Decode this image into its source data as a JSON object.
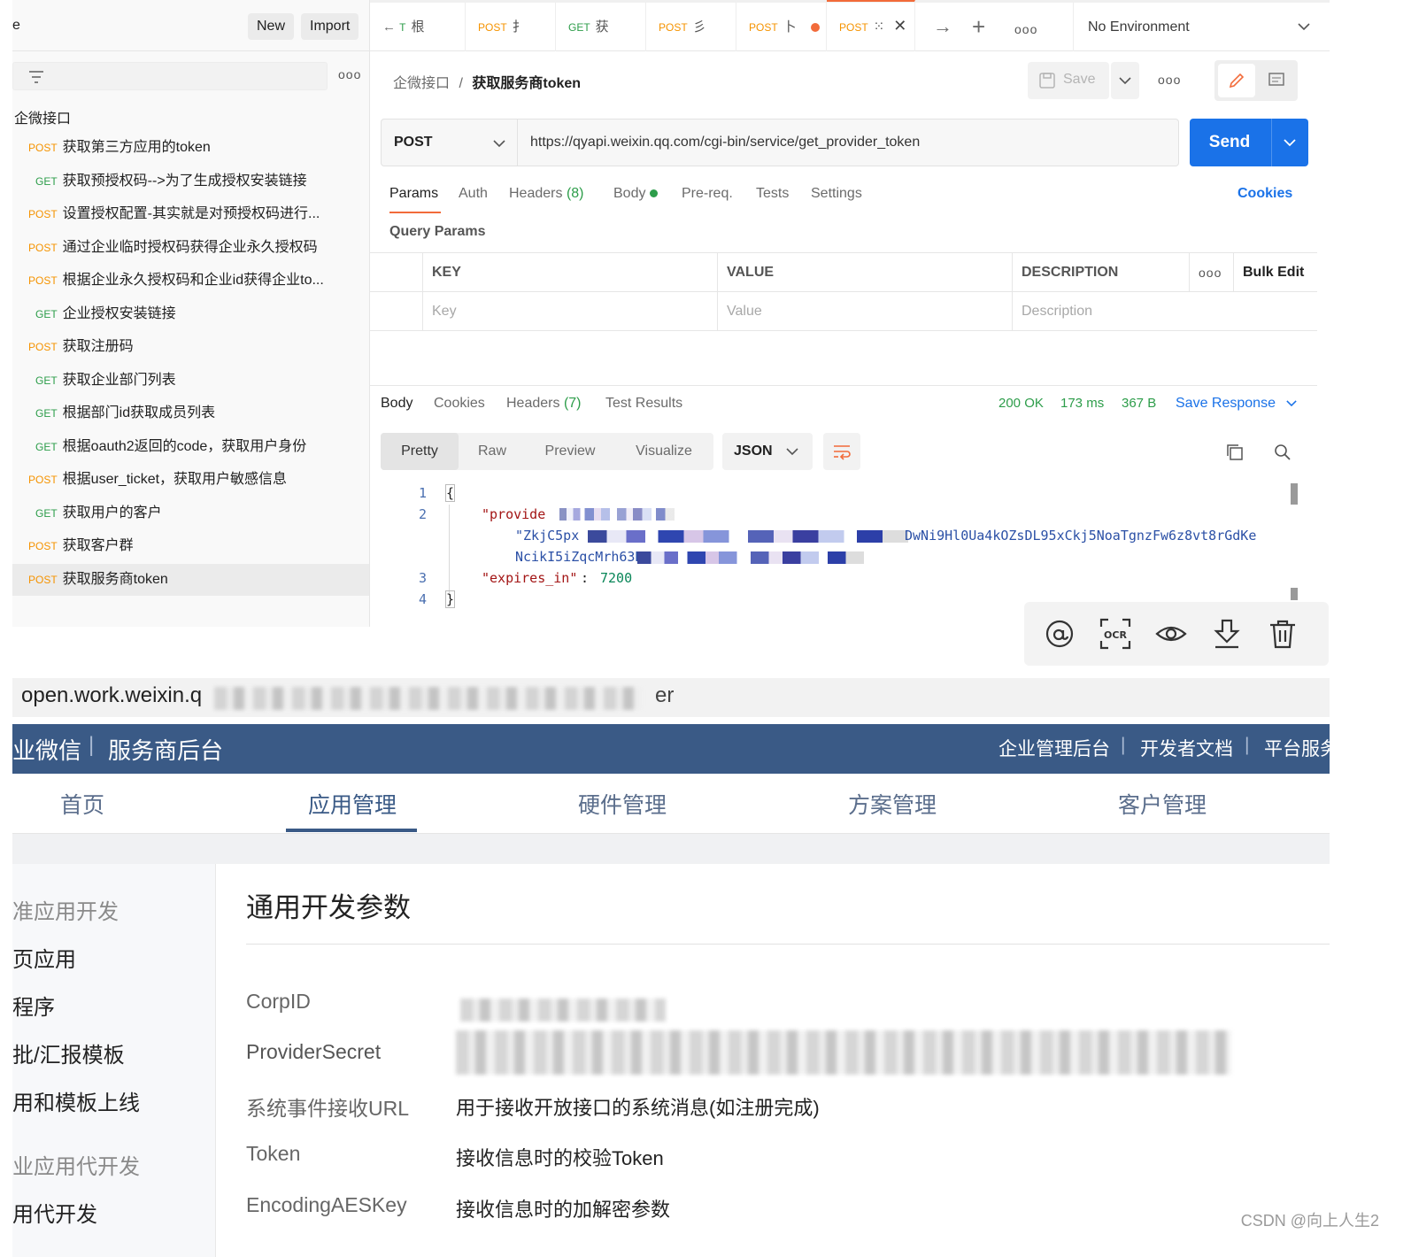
{
  "postman": {
    "sidebar": {
      "workspace_initial": "e",
      "new_label": "New",
      "import_label": "Import",
      "collection": "企微接口",
      "items": [
        {
          "method": "POST",
          "name": "获取第三方应用的token"
        },
        {
          "method": "GET",
          "name": "获取预授权码-->为了生成授权安装链接"
        },
        {
          "method": "POST",
          "name": "设置授权配置-其实就是对预授权码进行..."
        },
        {
          "method": "POST",
          "name": "通过企业临时授权码获得企业永久授权码"
        },
        {
          "method": "POST",
          "name": "根据企业永久授权码和企业id获得企业to..."
        },
        {
          "method": "GET",
          "name": "企业授权安装链接"
        },
        {
          "method": "POST",
          "name": "获取注册码"
        },
        {
          "method": "GET",
          "name": "获取企业部门列表"
        },
        {
          "method": "GET",
          "name": "根据部门id获取成员列表"
        },
        {
          "method": "GET",
          "name": "根据oauth2返回的code，获取用户身份"
        },
        {
          "method": "POST",
          "name": "根据user_ticket，获取用户敏感信息"
        },
        {
          "method": "GET",
          "name": "获取用户的客户"
        },
        {
          "method": "POST",
          "name": "获取客户群"
        },
        {
          "method": "POST",
          "name": "获取服务商token",
          "selected": true
        }
      ]
    },
    "tabs": [
      {
        "method": "T",
        "name": "根"
      },
      {
        "method": "POST",
        "name": "扌"
      },
      {
        "method": "GET",
        "name": "获"
      },
      {
        "method": "POST",
        "name": "彡"
      },
      {
        "method": "POST",
        "name": "卜",
        "unsaved": true
      },
      {
        "method": "POST",
        "name": "⁙",
        "active": true
      }
    ],
    "environment": "No Environment",
    "breadcrumb": {
      "collection": "企微接口",
      "separator": "/",
      "request": "获取服务商token"
    },
    "save_label": "Save",
    "request": {
      "method": "POST",
      "url": "https://qyapi.weixin.qq.com/cgi-bin/service/get_provider_token",
      "send_label": "Send"
    },
    "request_tabs": {
      "params": "Params",
      "auth": "Auth",
      "headers": "Headers",
      "headers_count": "(8)",
      "body": "Body",
      "prereq": "Pre-req.",
      "tests": "Tests",
      "settings": "Settings",
      "cookies": "Cookies"
    },
    "query_params": {
      "title": "Query Params",
      "col_key": "KEY",
      "col_value": "VALUE",
      "col_desc": "DESCRIPTION",
      "bulk_edit": "Bulk Edit",
      "ph_key": "Key",
      "ph_value": "Value",
      "ph_desc": "Description"
    },
    "response": {
      "tab_body": "Body",
      "tab_cookies": "Cookies",
      "tab_headers": "Headers",
      "headers_count": "(7)",
      "tab_tests": "Test Results",
      "status": "200 OK",
      "time": "173 ms",
      "size": "367 B",
      "save_response": "Save Response",
      "views": [
        "Pretty",
        "Raw",
        "Preview",
        "Visualize"
      ],
      "format": "JSON",
      "code": {
        "line_numbers": [
          "1",
          "2",
          "",
          "",
          "3",
          "4"
        ],
        "open_brace": "{",
        "key1": "\"provide",
        "val1_start": "\"ZkjC5px",
        "val1_end": "DwNi9Hl0Ua4kOZsDL95xCkj5NoaTgnzFw6z8vt8rGdKe",
        "val1_line2": "NcikI5iZqcMrh63K",
        "key2": "\"expires_in\"",
        "colon": ":",
        "val2": "7200",
        "close_brace": "}"
      }
    }
  },
  "weixin": {
    "address": "open.work.weixin.q",
    "address_tail": "er",
    "brand": "业微信",
    "brand_sep": "|",
    "brand_sub": "服务商后台",
    "header_links": [
      "企业管理后台",
      "开发者文档",
      "平台服务"
    ],
    "nav": [
      "首页",
      "应用管理",
      "硬件管理",
      "方案管理",
      "客户管理"
    ],
    "left_menu": [
      {
        "label": "准应用开发",
        "group": true
      },
      {
        "label": "页应用"
      },
      {
        "label": "程序"
      },
      {
        "label": "批/汇报模板"
      },
      {
        "label": "用和模板上线"
      },
      {
        "label": "业应用代开发",
        "group": true
      },
      {
        "label": "用代开发"
      }
    ],
    "section_title": "通用开发参数",
    "fields": [
      {
        "label": "CorpID",
        "value": ""
      },
      {
        "label": "ProviderSecret",
        "value": ""
      },
      {
        "label": "系统事件接收URL",
        "value": "用于接收开放接口的系统消息(如注册完成)"
      },
      {
        "label": "Token",
        "value": "接收信息时的校验Token"
      },
      {
        "label": "EncodingAESKey",
        "value": "接收信息时的加解密参数"
      }
    ]
  },
  "watermark": "CSDN @向上人生2"
}
